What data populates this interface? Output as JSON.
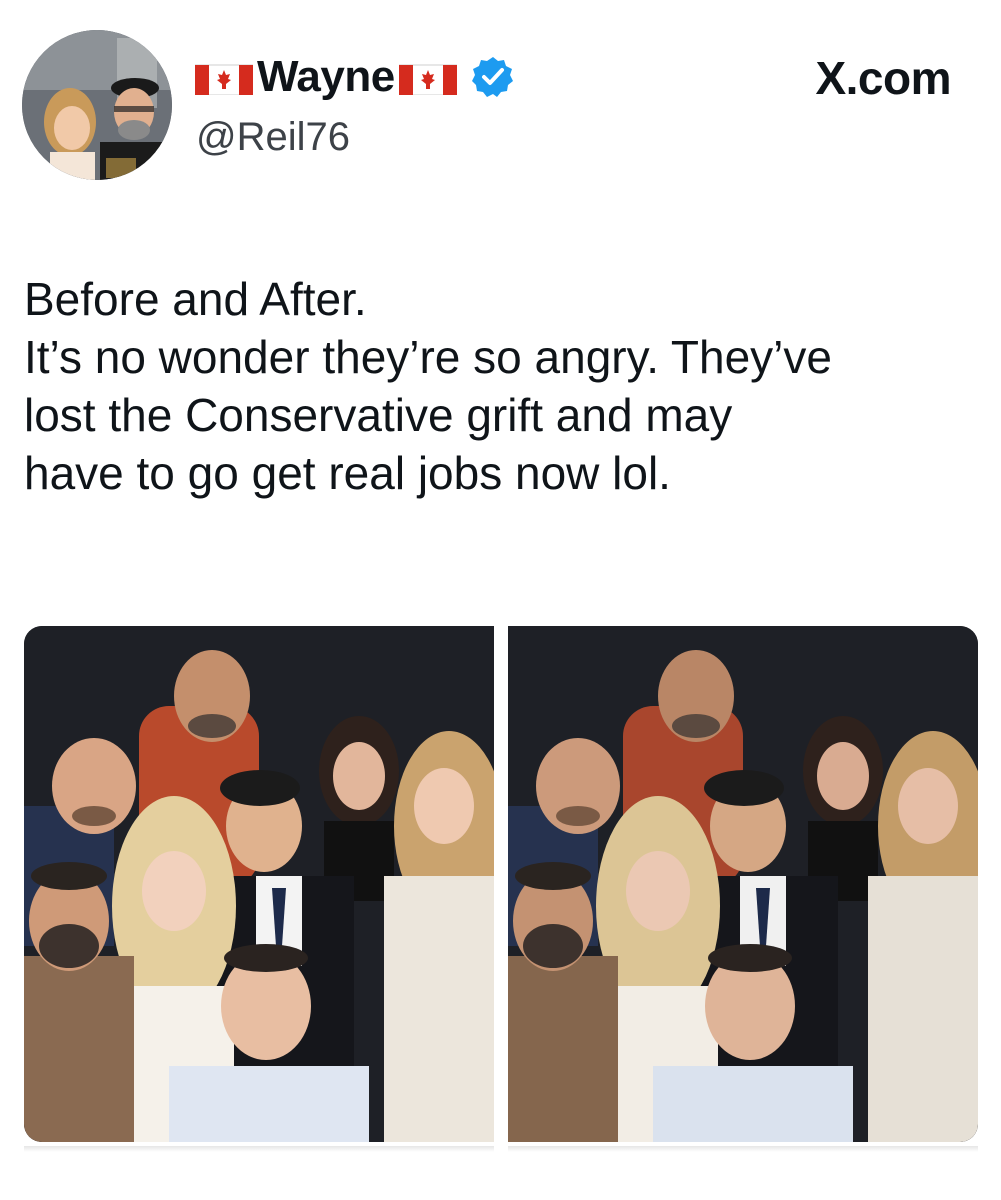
{
  "author": {
    "display_name": "Wayne",
    "handle": "@Reil76",
    "verified": true,
    "avatar": "profile-photo"
  },
  "source_label": "X.com",
  "tweet": {
    "lines": [
      "Before and After.",
      "It’s no wonder they’re so angry. They’ve",
      "lost the Conservative grift and may",
      "have to go get real jobs now lol."
    ]
  },
  "media": [
    {
      "name": "before-photo",
      "description_icon": "group-photo-smiling"
    },
    {
      "name": "after-photo",
      "description_icon": "group-photo-serious"
    }
  ],
  "colors": {
    "verified_blue": "#1d9bf0",
    "text": "#0f1419",
    "handle": "#3d4248",
    "flag_red": "#d52b1e"
  }
}
